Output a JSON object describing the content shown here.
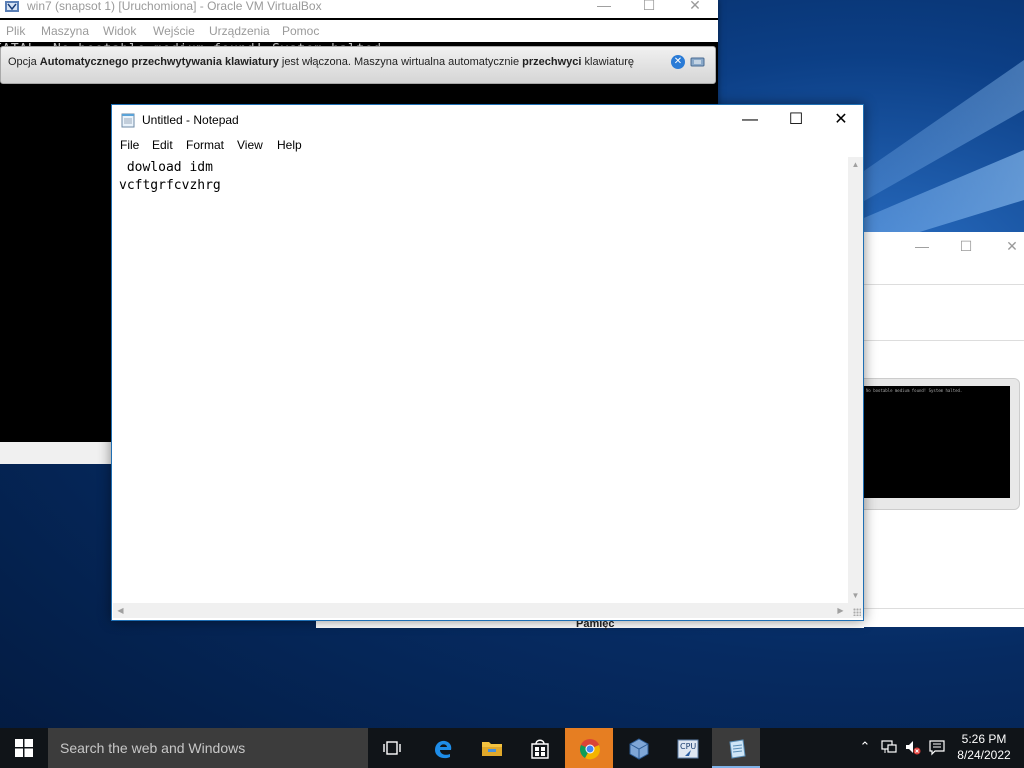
{
  "vbox": {
    "title": "win7 (snapsot 1) [Uruchomiona] - Oracle VM VirtualBox",
    "menu": [
      "Plik",
      "Maszyna",
      "Widok",
      "Wejście",
      "Urządzenia",
      "Pomoc"
    ],
    "fatal_text": "FATAL: No bootable medium found! System halted.",
    "notice": {
      "p1": "Opcja ",
      "b1": "Automatycznego przechwytywania klawiatury",
      "p2": " jest włączona. Maszyna wirtualna automatycznie ",
      "b2": "przechwyci",
      "p3": " klawiaturę"
    }
  },
  "right_window": {
    "preview_text": "No bootable medium found! System halted.",
    "partial_label": "Pamięć"
  },
  "notepad": {
    "title": "Untitled - Notepad",
    "menu": [
      "File",
      "Edit",
      "Format",
      "View",
      "Help"
    ],
    "content": " dowload idm\nvcftgrfcvzhrg"
  },
  "taskbar": {
    "search_placeholder": "Search the web and Windows",
    "apps": [
      "task-view",
      "edge",
      "file-explorer",
      "store",
      "chrome",
      "virtualbox",
      "cpuz",
      "notepad"
    ],
    "time": "5:26 PM",
    "date": "8/24/2022"
  },
  "colors": {
    "accent": "#1f6fb4",
    "taskbar": "#101418",
    "chrome_active": "#e67e22"
  }
}
